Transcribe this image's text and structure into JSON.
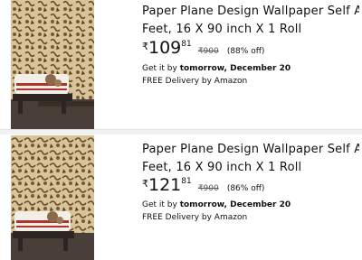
{
  "products": [
    {
      "title_line1": "Paper Plane Design Wallpaper Self Adhesive W",
      "title_line2": "Feet, 16 X 90 inch X 1 Roll",
      "currency": "₹",
      "price_whole": "109",
      "price_fraction": "81",
      "mrp": "₹900",
      "discount": "(88% off)",
      "delivery_prefix": "Get it by ",
      "delivery_date": "tomorrow, December 20",
      "free_delivery": "FREE Delivery by Amazon"
    },
    {
      "title_line1": "Paper Plane Design Wallpaper Self Adhesive W",
      "title_line2": "Feet, 16 X 90 inch X 1 Roll",
      "currency": "₹",
      "price_whole": "121",
      "price_fraction": "81",
      "mrp": "₹900",
      "discount": "(86% off)",
      "delivery_prefix": "Get it by ",
      "delivery_date": "tomorrow, December 20",
      "free_delivery": "FREE Delivery by Amazon"
    }
  ],
  "colors": {
    "wallpaper_base": "#d8c49a",
    "wallpaper_pattern": "#6b4a2a",
    "bench": "#3a2e27",
    "floor": "#4a3f38"
  }
}
